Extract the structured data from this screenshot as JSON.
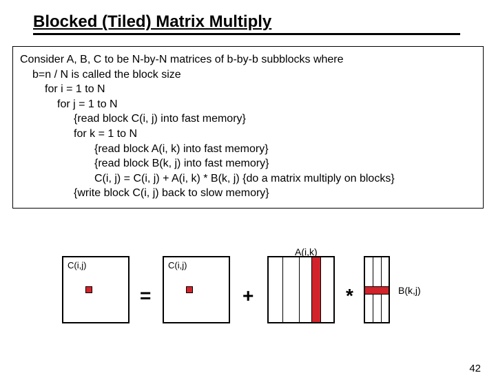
{
  "title": "Blocked (Tiled) Matrix Multiply",
  "code": {
    "line1": "Consider A, B, C to be N-by-N matrices of b-by-b subblocks where",
    "line2": "b=n / N is called the block size",
    "line3": "for i = 1 to N",
    "line4": "for j = 1 to N",
    "line5": "{read block C(i, j) into fast memory}",
    "line6": "for k = 1 to N",
    "line7": "{read block A(i, k) into fast memory}",
    "line8": "{read block B(k, j) into fast memory}",
    "line9": "C(i, j) = C(i, j) + A(i, k) * B(k, j)  {do a matrix multiply on blocks}",
    "line10": "{write block C(i, j) back to slow memory}"
  },
  "diagram": {
    "c_left_label": "C(i,j)",
    "c_right_label": "C(i,j)",
    "a_label": "A(i,k)",
    "b_label": "B(k,j)",
    "eq": "=",
    "plus": "+",
    "star": "*"
  },
  "page_number": "42"
}
